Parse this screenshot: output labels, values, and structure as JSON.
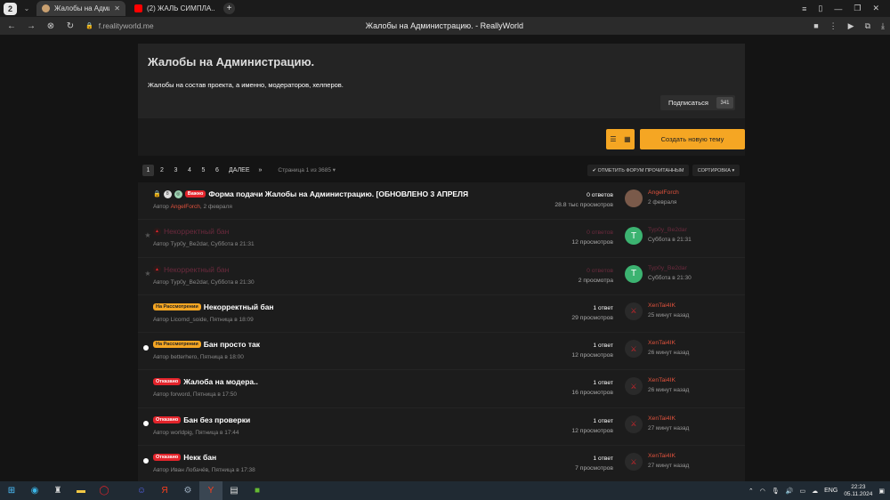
{
  "browser": {
    "workspace": "2",
    "tabs": [
      {
        "title": "Жалобы на Администрац",
        "active": true,
        "fav_color": "#c9a070"
      },
      {
        "title": "(2) ЖАЛЬ СИМПЛА... 😢",
        "active": false,
        "fav_color": "#ff0000"
      }
    ],
    "url_host": "f.realityworld.me",
    "page_title": "Жалобы на Администрацию. - ReallyWorld"
  },
  "forum": {
    "title": "Жалобы на Администрацию.",
    "description": "Жалобы на состав проекта, а именно, модераторов, хелперов.",
    "subscribe_label": "Подписаться",
    "subscribe_count": "341",
    "create_label": "Создать новую тему",
    "mark_read_label": "✔ ОТМЕТИТЬ ФОРУМ ПРОЧИТАННЫМ",
    "sort_label": "СОРТИРОВКА ▾"
  },
  "pager": {
    "pages": [
      "1",
      "2",
      "3",
      "4",
      "5",
      "6"
    ],
    "next_label": "ДАЛЕЕ",
    "arrow": "»",
    "info": "Страница 1 из 3685 ▾"
  },
  "threads": [
    {
      "marker": "lock",
      "badge": "Важно",
      "badge_type": "red",
      "title": "Форма подачи Жалобы на Администрацию. [ОБНОВЛЕНО 3 АПРЕЛЯ",
      "author_prefix": "Автор",
      "author": "AngelForch",
      "date": ", 2 февраля",
      "replies": "0 ответов",
      "views": "28.8 тыс просмотров",
      "last_user": "AngelForch",
      "last_time": "2 февраля",
      "avatar_letter": "",
      "avatar_color": "#7a5a4a",
      "faded": false
    },
    {
      "marker": "star",
      "badge": "",
      "badge_type": "",
      "title": "Некорректный бан",
      "author_prefix": "Автор",
      "author": "Typ0y_Be2dar",
      "date": ", Суббота в 21:31",
      "replies": "0 ответов",
      "views": "12 просмотров",
      "last_user": "Typ0y_Be2dar",
      "last_time": "Суббота в 21:31",
      "avatar_letter": "T",
      "avatar_color": "#3cb371",
      "faded": true
    },
    {
      "marker": "star",
      "badge": "",
      "badge_type": "",
      "title": "Некорректный бан",
      "author_prefix": "Автор",
      "author": "Typ0y_Be2dar",
      "date": ", Суббота в 21:30",
      "replies": "0 ответов",
      "views": "2 просмотра",
      "last_user": "Typ0y_Be2dar",
      "last_time": "Суббота в 21:30",
      "avatar_letter": "T",
      "avatar_color": "#3cb371",
      "faded": true
    },
    {
      "marker": "none",
      "badge": "На Рассмотрении",
      "badge_type": "orange",
      "title": "Некорректный бан",
      "author_prefix": "Автор",
      "author": "Licornd_soide",
      "date": ", Пятница в 18:09",
      "replies": "1 ответ",
      "views": "29 просмотров",
      "last_user": "XenTai4IK",
      "last_time": "25 минут назад",
      "avatar_letter": "",
      "avatar_color": "#2a2a2a",
      "faded": false
    },
    {
      "marker": "dot",
      "badge": "На Рассмотрении",
      "badge_type": "orange",
      "title": "Бан просто так",
      "author_prefix": "Автор",
      "author": "betterhero",
      "date": ", Пятница в 18:00",
      "replies": "1 ответ",
      "views": "12 просмотров",
      "last_user": "XenTai4IK",
      "last_time": "26 минут назад",
      "avatar_letter": "",
      "avatar_color": "#2a2a2a",
      "faded": false
    },
    {
      "marker": "none",
      "badge": "Отказано",
      "badge_type": "red",
      "title": "Жалоба на модера..",
      "author_prefix": "Автор",
      "author": "forword",
      "date": ", Пятница в 17:50",
      "replies": "1 ответ",
      "views": "16 просмотров",
      "last_user": "XenTai4IK",
      "last_time": "26 минут назад",
      "avatar_letter": "",
      "avatar_color": "#2a2a2a",
      "faded": false
    },
    {
      "marker": "dot",
      "badge": "Отказано",
      "badge_type": "red",
      "title": "Бан без проверки",
      "author_prefix": "Автор",
      "author": "worldpig",
      "date": ", Пятница в 17:44",
      "replies": "1 ответ",
      "views": "12 просмотров",
      "last_user": "XenTai4IK",
      "last_time": "27 минут назад",
      "avatar_letter": "",
      "avatar_color": "#2a2a2a",
      "faded": false
    },
    {
      "marker": "dot",
      "badge": "Отказано",
      "badge_type": "red",
      "title": "Некк бан",
      "author_prefix": "Автор",
      "author": "Иван Лобачёв",
      "date": ", Пятница в 17:38",
      "replies": "1 ответ",
      "views": "7 просмотров",
      "last_user": "XenTai4IK",
      "last_time": "27 минут назад",
      "avatar_letter": "",
      "avatar_color": "#2a2a2a",
      "faded": false
    }
  ],
  "taskbar": {
    "lang": "ENG",
    "time": "22:23",
    "date": "05.11.2024",
    "notif": "2"
  }
}
